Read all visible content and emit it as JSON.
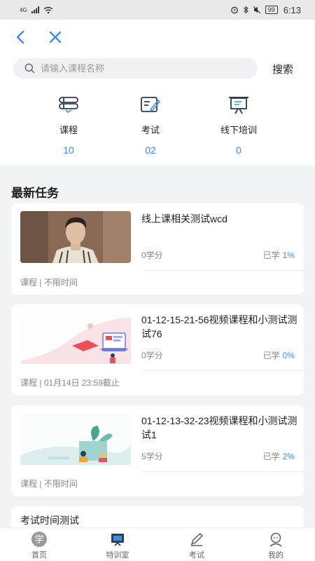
{
  "status_bar": {
    "signal_label": "4G",
    "battery": "99",
    "time": "6:13"
  },
  "nav": {
    "back_icon": "chevron-left-icon",
    "close_icon": "close-icon"
  },
  "search": {
    "placeholder": "请输入课程名称",
    "button_label": "搜索"
  },
  "stats": [
    {
      "label": "课程",
      "value": "10",
      "icon": "course-stack-icon"
    },
    {
      "label": "考试",
      "value": "02",
      "icon": "exam-edit-icon"
    },
    {
      "label": "线下培训",
      "value": "0",
      "icon": "presentation-board-icon"
    }
  ],
  "section_title": "最新任务",
  "tasks": [
    {
      "title": "线上课相关测试wcd",
      "credit": "0学分",
      "progress_label": "已学",
      "progress": "1%",
      "type": "课程",
      "deadline": "不限时间",
      "thumb": "person-photo"
    },
    {
      "title": "01-12-15-21-56视频课程和小测试测试76",
      "credit": "0学分",
      "progress_label": "已学",
      "progress": "0%",
      "type": "课程",
      "deadline": "01月14日 23:59截止",
      "thumb": "laptop-illustration"
    },
    {
      "title": "01-12-13-32-23视频课程和小测试测试1",
      "credit": "5学分",
      "progress_label": "已学",
      "progress": "2%",
      "type": "课程",
      "deadline": "不限时间",
      "thumb": "reading-illustration"
    },
    {
      "title": "考试时间测试"
    }
  ],
  "tabbar": [
    {
      "label": "首页",
      "icon": "home-xue-icon"
    },
    {
      "label": "特训室",
      "icon": "tv-training-icon"
    },
    {
      "label": "考试",
      "icon": "pen-exam-icon"
    },
    {
      "label": "我的",
      "icon": "profile-icon"
    }
  ],
  "colors": {
    "accent": "#3a8ee6",
    "background": "#f2f3f5"
  }
}
